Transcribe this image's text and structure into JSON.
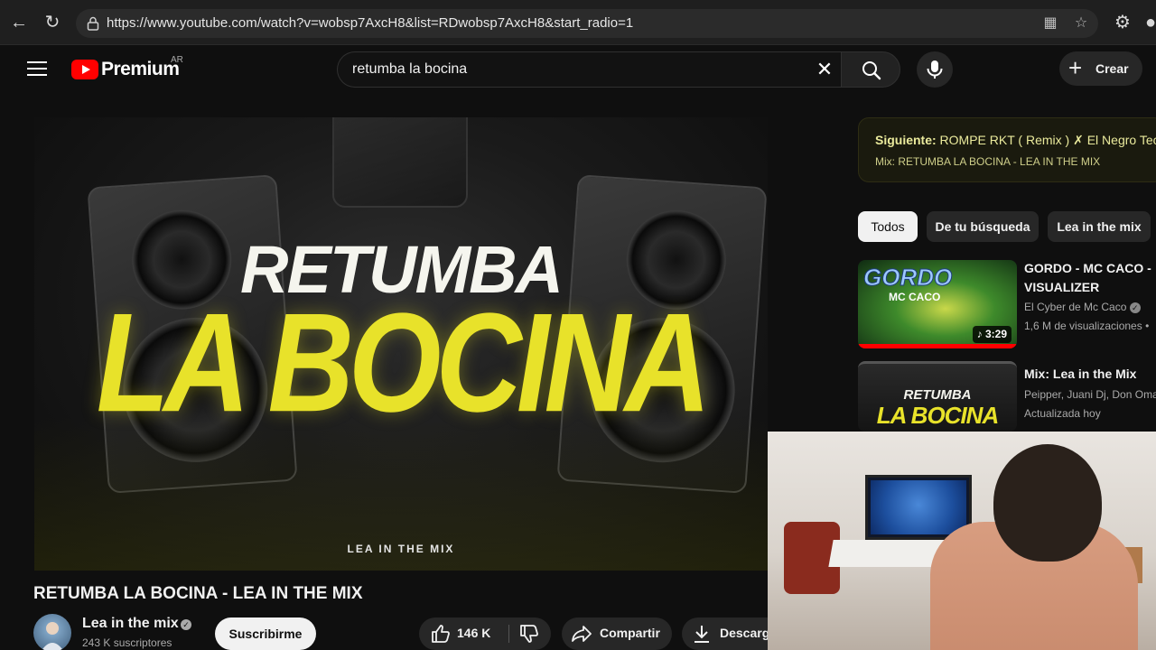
{
  "browser": {
    "url": "https://www.youtube.com/watch?v=wobsp7AxcH8&list=RDwobsp7AxcH8&start_radio=1"
  },
  "header": {
    "logo_text": "Premium",
    "region": "AR",
    "search_value": "retumba la bocina",
    "create_label": "Crear"
  },
  "player": {
    "thumb_line1": "RETUMBA",
    "thumb_line2": "LA BOCINA",
    "thumb_credit": "LEA IN THE MIX"
  },
  "video": {
    "title": "RETUMBA LA BOCINA - LEA IN THE MIX",
    "channel": "Lea in the mix",
    "subscribers": "243 K suscriptores",
    "subscribe_label": "Suscribirme",
    "likes": "146 K",
    "share_label": "Compartir",
    "download_label": "Descargar"
  },
  "sidebar": {
    "next_label": "Siguiente:",
    "next_title": " ROMPE RKT ( Remix ) ✗ El Negro Tecla",
    "next_mix": "Mix: RETUMBA LA BOCINA - LEA IN THE MIX",
    "chips": [
      "Todos",
      "De tu búsqueda",
      "Lea in the mix"
    ],
    "recommendations": [
      {
        "title_line1": "GORDO - MC CACO -",
        "title_line2": "VISUALIZER",
        "channel": "El Cyber de Mc Caco",
        "views": "1,6 M de visualizaciones •",
        "duration": "3:29",
        "thumb_text1": "GORDO",
        "thumb_text2": "MC CACO"
      },
      {
        "title_line1": "Mix: Lea in the Mix",
        "channel": "Peipper, Juani Dj, Don Omar",
        "views": "Actualizada hoy",
        "thumb_text1": "RETUMBA",
        "thumb_text2": "LA BOCINA"
      }
    ]
  },
  "colors": {
    "accent_red": "#ff0000",
    "thumb_yellow": "#e8e22a",
    "background": "#0f0f0f"
  }
}
